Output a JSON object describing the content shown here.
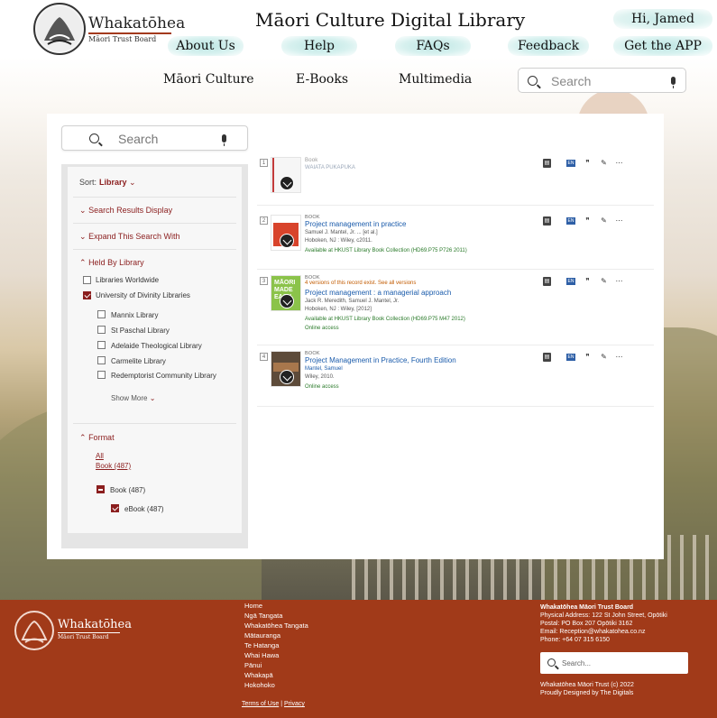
{
  "header": {
    "brand_name": "Whakatōhea",
    "brand_sub": "Māori Trust Board",
    "site_title": "Māori Culture Digital Library",
    "greeting": "Hi, Jamed",
    "nav": [
      "About Us",
      "Help",
      "FAQs",
      "Feedback",
      "Get the APP"
    ]
  },
  "subnav": {
    "items": [
      "Māori Culture",
      "E-Books",
      "Multimedia"
    ],
    "search_placeholder": "Search"
  },
  "sidebar": {
    "search_placeholder": "Search",
    "sort_label": "Sort:",
    "sort_value": "Library",
    "sections": {
      "search_results_display": "Search Results Display",
      "expand_search": "Expand This Search With",
      "held_by_library": "Held By Library",
      "format": "Format"
    },
    "libraries": [
      {
        "label": "Libraries Worldwide",
        "checked": false
      },
      {
        "label": "University of Divinity Libraries",
        "checked": true
      }
    ],
    "sub_libraries": [
      "Mannix Library",
      "St Paschal Library",
      "Adelaide Theological Library",
      "Carmelite Library",
      "Redemptorist Community Library"
    ],
    "show_more": "Show More",
    "format_links": [
      "All",
      "Book (487)"
    ],
    "format_book": "Book (487)",
    "format_ebook": "eBook (487)"
  },
  "results": [
    {
      "num": "1",
      "type": "Book",
      "title_secondary": "WAIATA PUKAPUKA"
    },
    {
      "num": "2",
      "type": "BOOK",
      "title": "Project management in practice",
      "author": "Samuel J. Mantel, Jr. ... [et al.]",
      "publisher": "Hoboken, NJ : Wiley, c2011.",
      "availability": "Available at HKUST Library  Book Collection (HD69.P75 P726 2011)"
    },
    {
      "num": "3",
      "type": "BOOK",
      "versions": "4 versions of this record exist. See all versions",
      "title": "Project management : a managerial approach",
      "author": "Jack R. Meredith, Samuel J. Mantel, Jr.",
      "publisher": "Hoboken, NJ : Wiley, [2012]",
      "availability": "Available at HKUST Library  Book Collection (HD69.P75 M47 2012)",
      "online": "Online access"
    },
    {
      "num": "4",
      "type": "BOOK",
      "title": "Project Management in Practice, Fourth Edition",
      "author": "Mantel, Samuel",
      "publisher": "Wiley, 2010.",
      "online": "Online access"
    }
  ],
  "result_actions": [
    "doc-icon",
    "translate-icon",
    "quote-icon",
    "pin-icon",
    "more-icon"
  ],
  "footer": {
    "brand_name": "Whakatōhea",
    "brand_sub": "Māori Trust Board",
    "nav": [
      "Home",
      "Ngā Tangata",
      "Whakatōhea Tangata",
      "Mātauranga",
      "Te Hatanga",
      "Whai Hawa",
      "Pānui",
      "Whakapā",
      "Hokohoko"
    ],
    "org_name": "Whakatōhea Māori Trust Board",
    "address": "Physical Address: 122 St John Street, Opōtiki",
    "postal": "Postal: PO Box 207 Opōtiki 3162",
    "email": "Email: Reception@whakatohea.co.nz",
    "phone": "Phone: +64 07 315 6150",
    "search_placeholder": "Search...",
    "copyright": "Whakatōhea Māori Trust (c) 2022",
    "designed": "Proudly Designed by The Digitals",
    "terms": "Terms of Use",
    "separator": "|",
    "privacy": "Privacy"
  },
  "colors": {
    "accent": "#8b1e1e",
    "footer": "#a13a19",
    "link": "#1a5bab",
    "nav_glow": "#bde6e3"
  }
}
